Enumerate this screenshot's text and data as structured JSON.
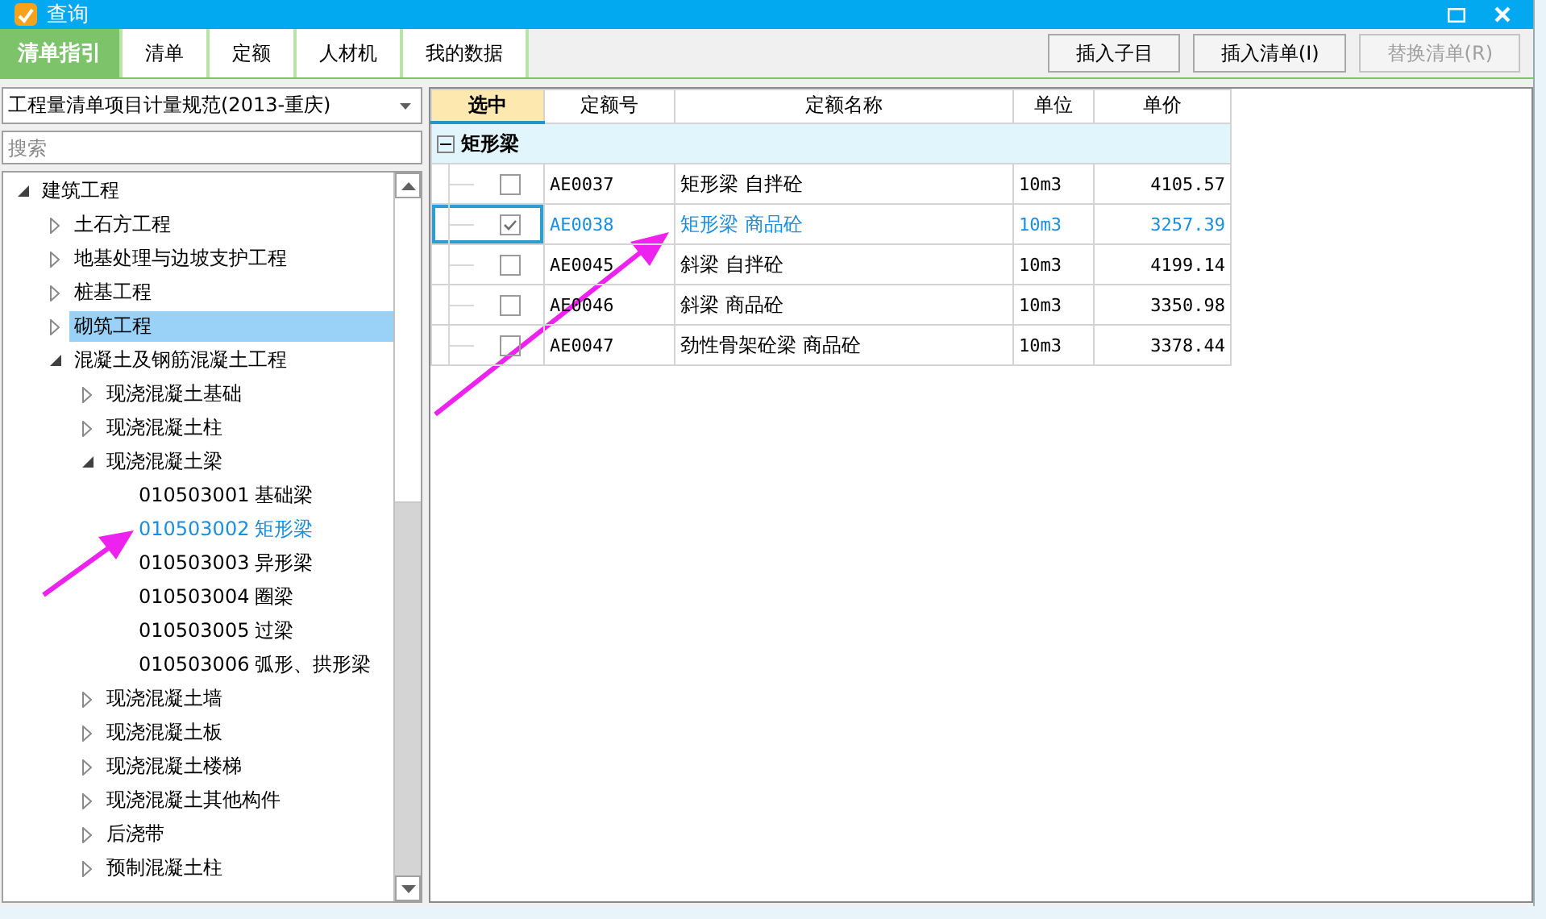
{
  "window": {
    "title": "查询"
  },
  "tabs": [
    {
      "label": "清单指引",
      "selected": true
    },
    {
      "label": "清单",
      "selected": false
    },
    {
      "label": "定额",
      "selected": false
    },
    {
      "label": "人材机",
      "selected": false
    },
    {
      "label": "我的数据",
      "selected": false
    }
  ],
  "buttons": [
    {
      "label": "插入子目",
      "disabled": false
    },
    {
      "label": "插入清单(I)",
      "disabled": false
    },
    {
      "label": "替换清单(R)",
      "disabled": true
    }
  ],
  "library_select": {
    "value": "工程量清单项目计量规范(2013-重庆)"
  },
  "search": {
    "placeholder": "搜索"
  },
  "tree": [
    {
      "kind": "folder",
      "label": "建筑工程",
      "expanded": true,
      "selected": false,
      "children": [
        {
          "kind": "folder",
          "label": "土石方工程",
          "expanded": false,
          "selected": false
        },
        {
          "kind": "folder",
          "label": "地基处理与边坡支护工程",
          "expanded": false,
          "selected": false
        },
        {
          "kind": "folder",
          "label": "桩基工程",
          "expanded": false,
          "selected": false
        },
        {
          "kind": "folder",
          "label": "砌筑工程",
          "expanded": false,
          "selected": true
        },
        {
          "kind": "folder",
          "label": "混凝土及钢筋混凝土工程",
          "expanded": true,
          "selected": false,
          "children": [
            {
              "kind": "folder",
              "label": "现浇混凝土基础",
              "expanded": false,
              "selected": false
            },
            {
              "kind": "folder",
              "label": "现浇混凝土柱",
              "expanded": false,
              "selected": false
            },
            {
              "kind": "folder",
              "label": "现浇混凝土梁",
              "expanded": true,
              "selected": false,
              "children": [
                {
                  "kind": "item",
                  "code": "010503001",
                  "label": "基础梁",
                  "selected": false
                },
                {
                  "kind": "item",
                  "code": "010503002",
                  "label": "矩形梁",
                  "selected": true
                },
                {
                  "kind": "item",
                  "code": "010503003",
                  "label": "异形梁",
                  "selected": false
                },
                {
                  "kind": "item",
                  "code": "010503004",
                  "label": "圈梁",
                  "selected": false
                },
                {
                  "kind": "item",
                  "code": "010503005",
                  "label": "过梁",
                  "selected": false
                },
                {
                  "kind": "item",
                  "code": "010503006",
                  "label": "弧形、拱形梁",
                  "selected": false
                }
              ]
            },
            {
              "kind": "folder",
              "label": "现浇混凝土墙",
              "expanded": false,
              "selected": false
            },
            {
              "kind": "folder",
              "label": "现浇混凝土板",
              "expanded": false,
              "selected": false
            },
            {
              "kind": "folder",
              "label": "现浇混凝土楼梯",
              "expanded": false,
              "selected": false
            },
            {
              "kind": "folder",
              "label": "现浇混凝土其他构件",
              "expanded": false,
              "selected": false
            },
            {
              "kind": "folder",
              "label": "后浇带",
              "expanded": false,
              "selected": false
            },
            {
              "kind": "folder",
              "label": "预制混凝土柱",
              "expanded": false,
              "selected": false
            }
          ]
        }
      ]
    }
  ],
  "grid": {
    "columns": [
      "选中",
      "定额号",
      "定额名称",
      "单位",
      "单价"
    ],
    "group": {
      "label": "矩形梁",
      "expanded": true
    },
    "rows": [
      {
        "checked": false,
        "selected": false,
        "code": "AE0037",
        "name": "矩形梁 自拌砼",
        "unit": "10m3",
        "price": "4105.57"
      },
      {
        "checked": true,
        "selected": true,
        "code": "AE0038",
        "name": "矩形梁 商品砼",
        "unit": "10m3",
        "price": "3257.39"
      },
      {
        "checked": false,
        "selected": false,
        "code": "AE0045",
        "name": "斜梁 自拌砼",
        "unit": "10m3",
        "price": "4199.14"
      },
      {
        "checked": false,
        "selected": false,
        "code": "AE0046",
        "name": "斜梁 商品砼",
        "unit": "10m3",
        "price": "3350.98"
      },
      {
        "checked": false,
        "selected": false,
        "code": "AE0047",
        "name": "劲性骨架砼梁 商品砼",
        "unit": "10m3",
        "price": "3378.44"
      }
    ]
  }
}
